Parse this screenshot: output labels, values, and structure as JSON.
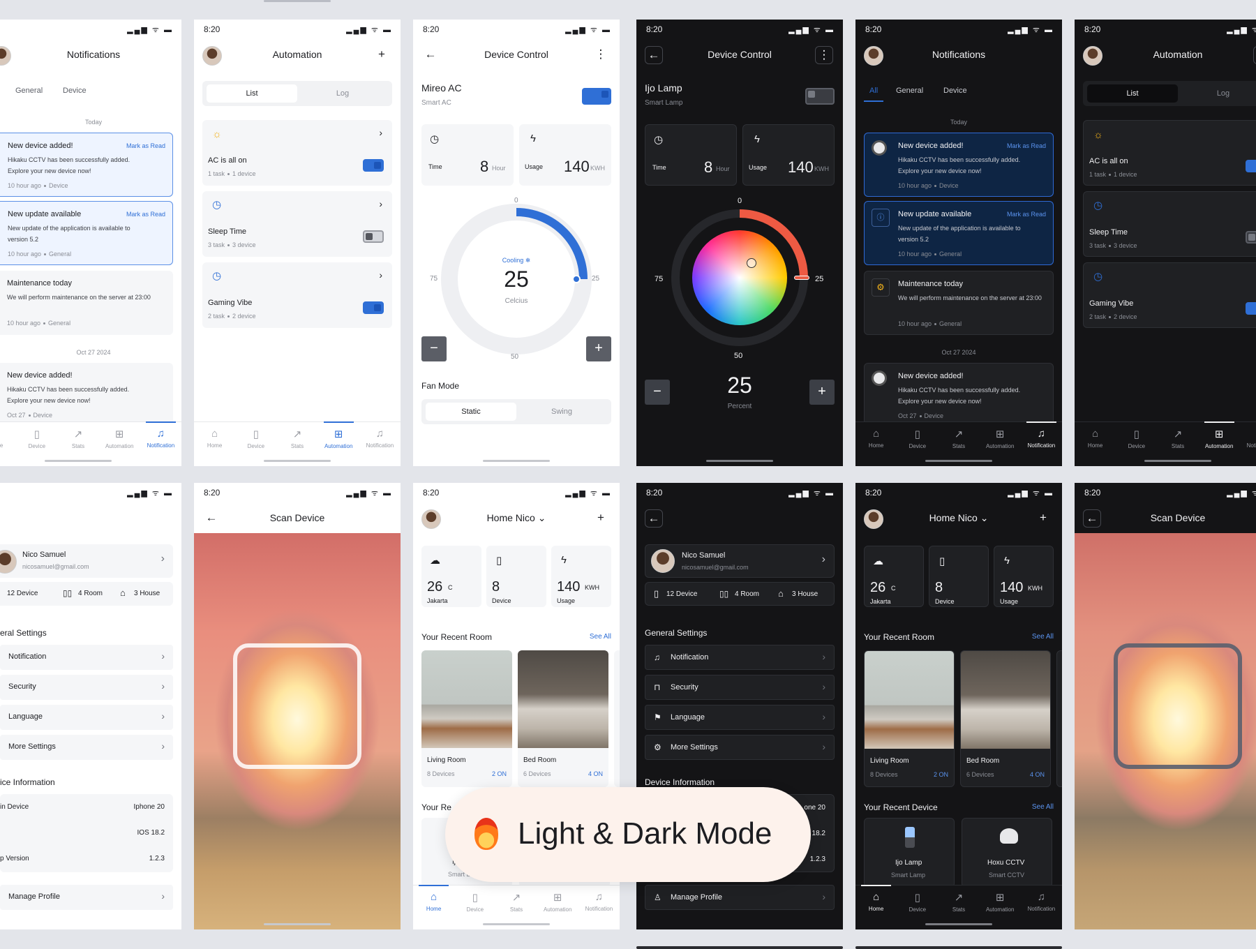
{
  "status": {
    "time": "8:20",
    "icons": "▂▄▆ ᯤ ▬"
  },
  "nav": [
    "Home",
    "Device",
    "Stats",
    "Automation",
    "Notification"
  ],
  "nav_icons": [
    "home-icon",
    "device-icon",
    "stats-icon",
    "automation-icon",
    "notification-icon"
  ],
  "notifications": {
    "title": "Notifications",
    "tabs": [
      "All",
      "General",
      "Device"
    ],
    "today": "Today",
    "older": "Oct 27 2024",
    "mark": "Mark as Read",
    "items": [
      {
        "title": "New device added!",
        "body": "Hikaku CCTV has been successfully added. Explore your new device now!",
        "meta": "10 hour ago",
        "cat": "Device",
        "selected": true
      },
      {
        "title": "New update available",
        "body": "New update of the application is available to version 5.2",
        "meta": "10 hour ago",
        "cat": "General",
        "selected": true
      },
      {
        "title": "Maintenance today",
        "body": "We will perform maintenance on the server at 23:00",
        "meta": "10 hour ago",
        "cat": "General",
        "selected": false
      },
      {
        "title": "New device added!",
        "body": "Hikaku CCTV has been successfully added. Explore your new device now!",
        "meta": "Oct 27",
        "cat": "Device",
        "selected": false
      }
    ]
  },
  "automation": {
    "title": "Automation",
    "tabs": [
      "List",
      "Log"
    ],
    "items": [
      {
        "name": "AC is all on",
        "task": "1 task",
        "devices": "1 device",
        "on": true
      },
      {
        "name": "Sleep Time",
        "task": "3 task",
        "devices": "3 device",
        "on": false
      },
      {
        "name": "Gaming Vibe",
        "task": "2 task",
        "devices": "2 device",
        "on": true
      }
    ]
  },
  "ac": {
    "title": "Device Control",
    "name": "Mireo AC",
    "type": "Smart AC",
    "time_label": "Time",
    "time_value": "8",
    "time_unit": "Hour",
    "usage_label": "Usage",
    "usage_value": "140",
    "usage_unit": "KWH",
    "dial_top": "0",
    "dial_left": "75",
    "dial_right": "25",
    "dial_bottom": "50",
    "mode": "Cooling",
    "temp": "25",
    "temp_unit": "Celcius",
    "fan_title": "Fan Mode",
    "fan_options": [
      "Static",
      "Swing"
    ],
    "temp_level": 0.5
  },
  "lamp": {
    "title": "Device Control",
    "name": "Ijo Lamp",
    "type": "Smart Lamp",
    "time_label": "Time",
    "time_value": "8",
    "time_unit": "Hour",
    "usage_label": "Usage",
    "usage_value": "140",
    "usage_unit": "KWH",
    "dial_top": "0",
    "dial_left": "75",
    "dial_right": "25",
    "dial_bottom": "50",
    "value": "25",
    "value_unit": "Percent"
  },
  "profile": {
    "name": "Nico Samuel",
    "email": "nicosamuel@gmail.com",
    "device_count": "12 Device",
    "room_count": "4 Room",
    "house_count": "3 House",
    "general_title": "General Settings",
    "general_title_cut": "eral Settings",
    "settings": [
      "Notification",
      "Security",
      "Language",
      "More Settings"
    ],
    "info_title": "Device Information",
    "info_title_cut": "ice Information",
    "info": [
      {
        "label": "Main Device",
        "label_cut": "in Device",
        "value": "Iphone 20",
        "value_cut": "one 20"
      },
      {
        "label": "",
        "label_cut": "",
        "value": "IOS 18.2",
        "value_cut": "18.2"
      },
      {
        "label": "App Version",
        "label_cut": "p Version",
        "value": "1.2.3",
        "value_cut": "1.2.3"
      }
    ],
    "manage": "Manage Profile"
  },
  "scan": {
    "title": "Scan Device"
  },
  "home": {
    "title": "Home Nico",
    "stats": [
      {
        "value": "26",
        "unit": "C",
        "label": "Jakarta"
      },
      {
        "value": "8",
        "unit": "",
        "label": "Device"
      },
      {
        "value": "140",
        "unit": "KWH",
        "label": "Usage"
      }
    ],
    "recent_room": "Your Recent Room",
    "see_all": "See All",
    "rooms": [
      {
        "name": "Living Room",
        "devices": "8 Devices",
        "on": "2 ON"
      },
      {
        "name": "Bed Room",
        "devices": "6 Devices",
        "on": "4 ON"
      }
    ],
    "recent_device": "Your Recent Device",
    "recent_device_cut": "Your Re",
    "devices": [
      {
        "name": "Ijo Lamp",
        "type": "Smart Lamp"
      },
      {
        "name": "Hoxu CCTV",
        "type": "Smart CCTV"
      }
    ]
  },
  "banner": {
    "text": "Light & Dark Mode"
  },
  "colors": {
    "accent": "#2f6fd6",
    "dark_bg": "#141416",
    "light_bg": "#ffffff",
    "page_bg": "#e3e5ea"
  }
}
